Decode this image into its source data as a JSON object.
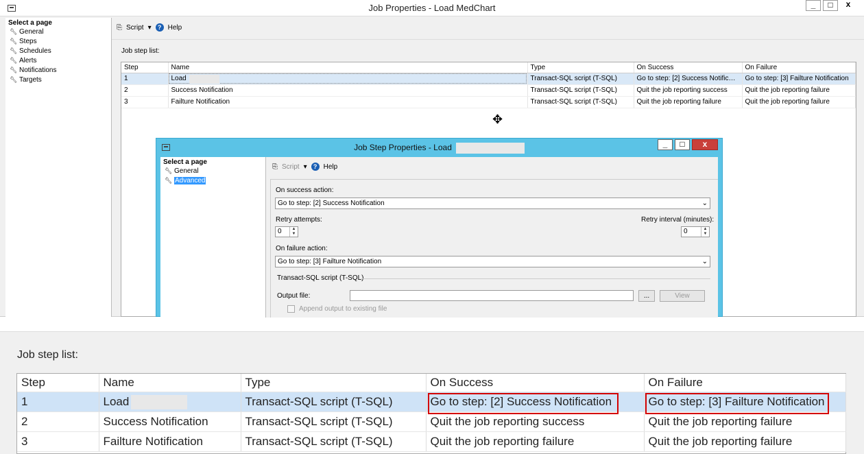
{
  "main_window": {
    "title": "Job Properties - Load MedChart",
    "select_page": "Select a page",
    "pages": [
      "General",
      "Steps",
      "Schedules",
      "Alerts",
      "Notifications",
      "Targets"
    ],
    "toolbar": {
      "script": "Script",
      "help": "Help"
    },
    "job_step_list_label": "Job step list:",
    "columns": [
      "Step",
      "Name",
      "Type",
      "On Success",
      "On Failure"
    ],
    "rows": [
      [
        "1",
        "Load",
        "Transact-SQL script (T-SQL)",
        "Go to step: [2] Success Notificat...",
        "Go to step: [3] Failture Notification"
      ],
      [
        "2",
        "Success Notification",
        "Transact-SQL script (T-SQL)",
        "Quit the job reporting success",
        "Quit the job reporting failure"
      ],
      [
        "3",
        "Failture Notification",
        "Transact-SQL script (T-SQL)",
        "Quit the job reporting failure",
        "Quit the job reporting failure"
      ]
    ]
  },
  "step_dialog": {
    "title": "Job Step Properties - Load",
    "select_page": "Select a page",
    "pages": [
      "General",
      "Advanced"
    ],
    "selected_page": "Advanced",
    "toolbar": {
      "script": "Script",
      "help": "Help"
    },
    "on_success_label": "On success action:",
    "on_success_value": "Go to step: [2] Success Notification",
    "retry_attempts_label": "Retry attempts:",
    "retry_attempts_value": "0",
    "retry_interval_label": "Retry interval (minutes):",
    "retry_interval_value": "0",
    "on_failure_label": "On failure action:",
    "on_failure_value": "Go to step: [3] Failture Notification",
    "tsql_group_label": "Transact-SQL script (T-SQL)",
    "output_file_label": "Output file:",
    "output_file_value": "",
    "browse_label": "...",
    "view_label": "View",
    "append_label": "Append output to existing file"
  },
  "zoomed": {
    "job_step_list_label": "Job step list:",
    "columns": [
      "Step",
      "Name",
      "Type",
      "On Success",
      "On Failure"
    ],
    "rows": [
      [
        "1",
        "Load",
        "Transact-SQL script (T-SQL)",
        "Go to step: [2] Success Notification",
        "Go to step: [3] Failture Notification"
      ],
      [
        "2",
        "Success Notification",
        "Transact-SQL script (T-SQL)",
        "Quit the job reporting success",
        "Quit the job reporting failure"
      ],
      [
        "3",
        "Failture Notification",
        "Transact-SQL script (T-SQL)",
        "Quit the job reporting failure",
        "Quit the job reporting failure"
      ]
    ]
  },
  "colors": {
    "dialog_title_bar": "#5bc3e6",
    "selection": "#d9e8f7",
    "highlight": "#d40000",
    "close_button": "#c9403a"
  }
}
